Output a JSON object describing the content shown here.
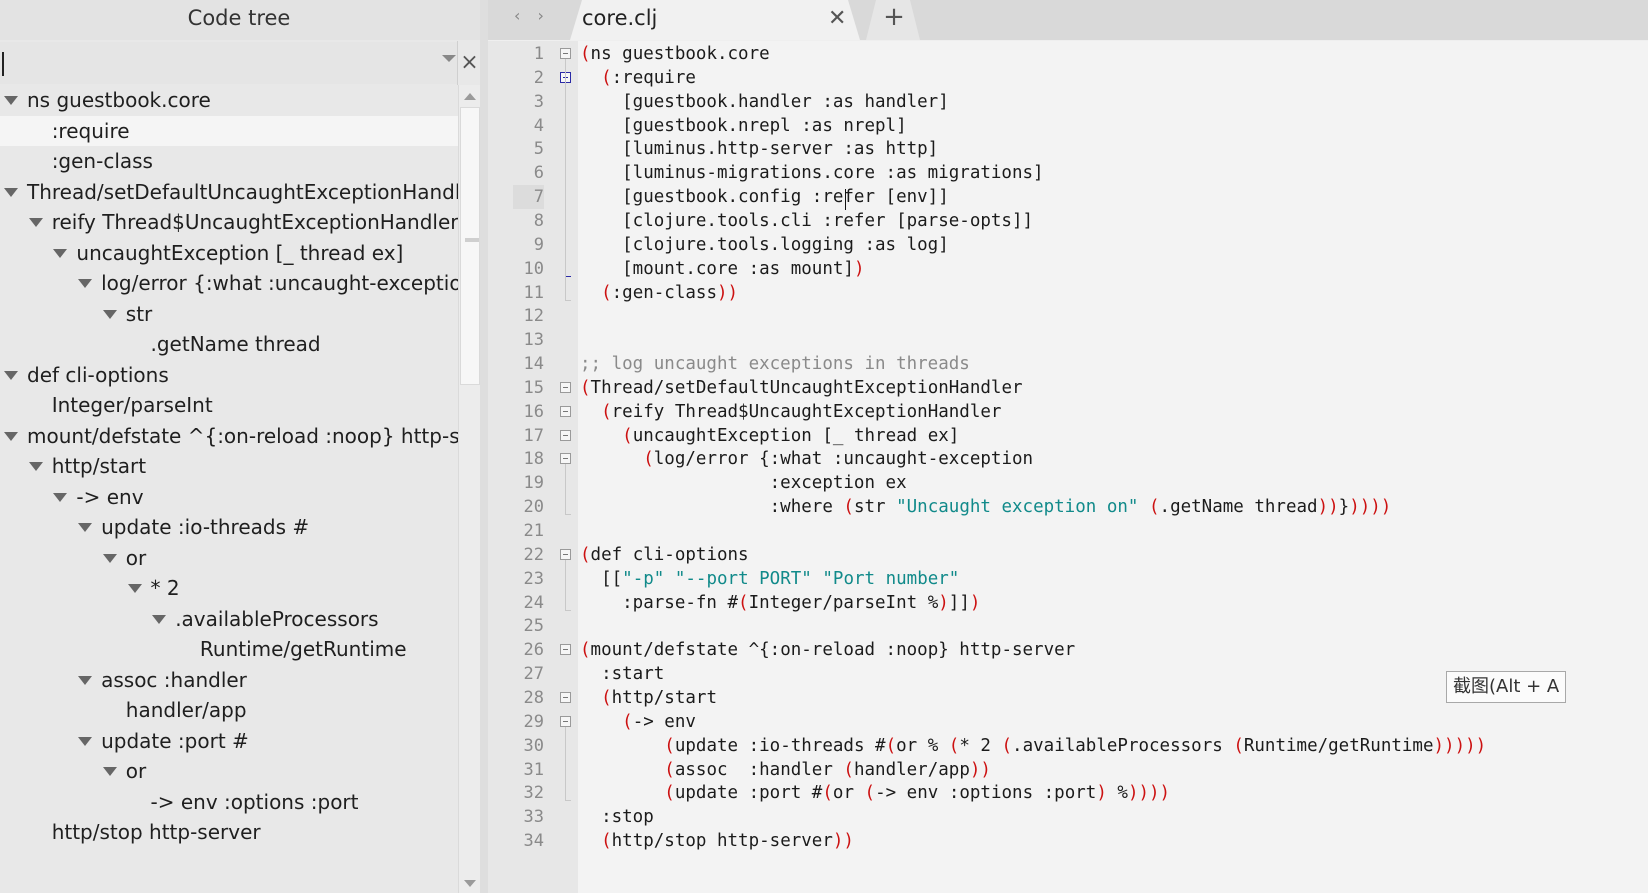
{
  "tree": {
    "title": "Code tree",
    "filter": {
      "value": "",
      "placeholder": ""
    },
    "close_glyph": "×",
    "items": [
      {
        "label": "ns guestbook.core",
        "depth": 0,
        "expandable": true,
        "selected": false
      },
      {
        "label": ":require",
        "depth": 1,
        "expandable": false,
        "selected": true
      },
      {
        "label": ":gen-class",
        "depth": 1,
        "expandable": false,
        "selected": false
      },
      {
        "label": "Thread/setDefaultUncaughtExceptionHandler",
        "depth": 0,
        "expandable": true,
        "selected": false
      },
      {
        "label": "reify Thread$UncaughtExceptionHandler",
        "depth": 1,
        "expandable": true,
        "selected": false
      },
      {
        "label": "uncaughtException [_ thread ex]",
        "depth": 2,
        "expandable": true,
        "selected": false
      },
      {
        "label": "log/error {:what :uncaught-exception",
        "depth": 3,
        "expandable": true,
        "selected": false
      },
      {
        "label": "str",
        "depth": 4,
        "expandable": true,
        "selected": false
      },
      {
        "label": ".getName thread",
        "depth": 5,
        "expandable": false,
        "selected": false
      },
      {
        "label": "def cli-options",
        "depth": 0,
        "expandable": true,
        "selected": false
      },
      {
        "label": "Integer/parseInt",
        "depth": 1,
        "expandable": false,
        "selected": false
      },
      {
        "label": "mount/defstate ^{:on-reload :noop} http-server",
        "depth": 0,
        "expandable": true,
        "selected": false
      },
      {
        "label": "http/start",
        "depth": 1,
        "expandable": true,
        "selected": false
      },
      {
        "label": "-> env",
        "depth": 2,
        "expandable": true,
        "selected": false
      },
      {
        "label": "update :io-threads #",
        "depth": 3,
        "expandable": true,
        "selected": false
      },
      {
        "label": "or",
        "depth": 4,
        "expandable": true,
        "selected": false
      },
      {
        "label": "* 2",
        "depth": 5,
        "expandable": true,
        "selected": false
      },
      {
        "label": ".availableProcessors",
        "depth": 6,
        "expandable": true,
        "selected": false
      },
      {
        "label": "Runtime/getRuntime",
        "depth": 7,
        "expandable": false,
        "selected": false
      },
      {
        "label": "assoc  :handler",
        "depth": 3,
        "expandable": true,
        "selected": false
      },
      {
        "label": "handler/app",
        "depth": 4,
        "expandable": false,
        "selected": false
      },
      {
        "label": "update :port #",
        "depth": 3,
        "expandable": true,
        "selected": false
      },
      {
        "label": "or",
        "depth": 4,
        "expandable": true,
        "selected": false
      },
      {
        "label": "-> env :options :port",
        "depth": 5,
        "expandable": false,
        "selected": false
      },
      {
        "label": "http/stop http-server",
        "depth": 1,
        "expandable": false,
        "selected": false
      }
    ]
  },
  "tabs": {
    "nav_label": "‹ ›",
    "active": {
      "label": "core.clj",
      "close_glyph": "✕"
    },
    "add_label": "+"
  },
  "editor": {
    "current_line": 7,
    "lines": [
      {
        "n": "1",
        "fold": "open",
        "segs": [
          [
            "p",
            "("
          ],
          [
            "t",
            "ns guestbook.core"
          ]
        ]
      },
      {
        "n": "2",
        "fold": "open-active",
        "segs": [
          [
            "t",
            "  "
          ],
          [
            "p",
            "("
          ],
          [
            "t",
            ":require"
          ]
        ]
      },
      {
        "n": "3",
        "fold": "",
        "segs": [
          [
            "t",
            "    [guestbook.handler :as handler]"
          ]
        ]
      },
      {
        "n": "4",
        "fold": "",
        "segs": [
          [
            "t",
            "    [guestbook.nrepl :as nrepl]"
          ]
        ]
      },
      {
        "n": "5",
        "fold": "",
        "segs": [
          [
            "t",
            "    [luminus.http-server :as http]"
          ]
        ]
      },
      {
        "n": "6",
        "fold": "",
        "segs": [
          [
            "t",
            "    [luminus-migrations.core :as migrations]"
          ]
        ]
      },
      {
        "n": "7",
        "fold": "",
        "segs": [
          [
            "t",
            "    [guestbook.config :refer [env]]"
          ]
        ]
      },
      {
        "n": "8",
        "fold": "",
        "segs": [
          [
            "t",
            "    [clojure.tools.cli :refer [parse-opts]]"
          ]
        ]
      },
      {
        "n": "9",
        "fold": "",
        "segs": [
          [
            "t",
            "    [clojure.tools.logging :as log]"
          ]
        ]
      },
      {
        "n": "10",
        "fold": "end-active",
        "segs": [
          [
            "t",
            "    [mount.core :as mount]"
          ],
          [
            "p",
            ")"
          ]
        ]
      },
      {
        "n": "11",
        "fold": "end",
        "segs": [
          [
            "t",
            "  "
          ],
          [
            "p",
            "("
          ],
          [
            "t",
            ":gen-class"
          ],
          [
            "p",
            "))"
          ]
        ]
      },
      {
        "n": "12",
        "fold": "",
        "segs": []
      },
      {
        "n": "13",
        "fold": "",
        "segs": []
      },
      {
        "n": "14",
        "fold": "",
        "segs": [
          [
            "c",
            ";; log uncaught exceptions in threads"
          ]
        ]
      },
      {
        "n": "15",
        "fold": "open",
        "segs": [
          [
            "p",
            "("
          ],
          [
            "t",
            "Thread/setDefaultUncaughtExceptionHandler"
          ]
        ]
      },
      {
        "n": "16",
        "fold": "open",
        "segs": [
          [
            "t",
            "  "
          ],
          [
            "p",
            "("
          ],
          [
            "t",
            "reify Thread$UncaughtExceptionHandler"
          ]
        ]
      },
      {
        "n": "17",
        "fold": "open",
        "segs": [
          [
            "t",
            "    "
          ],
          [
            "p",
            "("
          ],
          [
            "t",
            "uncaughtException [_ thread ex]"
          ]
        ]
      },
      {
        "n": "18",
        "fold": "open",
        "segs": [
          [
            "t",
            "      "
          ],
          [
            "p",
            "("
          ],
          [
            "t",
            "log/error {:what :uncaught-exception"
          ]
        ]
      },
      {
        "n": "19",
        "fold": "",
        "segs": [
          [
            "t",
            "                  :exception ex"
          ]
        ]
      },
      {
        "n": "20",
        "fold": "end",
        "segs": [
          [
            "t",
            "                  :where "
          ],
          [
            "p",
            "("
          ],
          [
            "t",
            "str "
          ],
          [
            "s",
            "\"Uncaught exception on\""
          ],
          [
            "t",
            " "
          ],
          [
            "p",
            "("
          ],
          [
            "t",
            ".getName thread"
          ],
          [
            "p",
            "))"
          ],
          [
            "t",
            "}"
          ],
          [
            "p",
            "))))"
          ]
        ]
      },
      {
        "n": "21",
        "fold": "",
        "segs": []
      },
      {
        "n": "22",
        "fold": "open",
        "segs": [
          [
            "p",
            "("
          ],
          [
            "t",
            "def cli-options"
          ]
        ]
      },
      {
        "n": "23",
        "fold": "",
        "segs": [
          [
            "t",
            "  [["
          ],
          [
            "s",
            "\"-p\""
          ],
          [
            "t",
            " "
          ],
          [
            "s",
            "\"--port PORT\""
          ],
          [
            "t",
            " "
          ],
          [
            "s",
            "\"Port number\""
          ]
        ]
      },
      {
        "n": "24",
        "fold": "end",
        "segs": [
          [
            "t",
            "    :parse-fn #"
          ],
          [
            "p",
            "("
          ],
          [
            "t",
            "Integer/parseInt %"
          ],
          [
            "p",
            ")"
          ],
          [
            "t",
            "]]"
          ],
          [
            "p",
            ")"
          ]
        ]
      },
      {
        "n": "25",
        "fold": "",
        "segs": []
      },
      {
        "n": "26",
        "fold": "open",
        "segs": [
          [
            "p",
            "("
          ],
          [
            "t",
            "mount/defstate ^{:on-reload :noop} http-server"
          ]
        ]
      },
      {
        "n": "27",
        "fold": "",
        "segs": [
          [
            "t",
            "  :start"
          ]
        ]
      },
      {
        "n": "28",
        "fold": "open",
        "segs": [
          [
            "t",
            "  "
          ],
          [
            "p",
            "("
          ],
          [
            "t",
            "http/start"
          ]
        ]
      },
      {
        "n": "29",
        "fold": "open",
        "segs": [
          [
            "t",
            "    "
          ],
          [
            "p",
            "("
          ],
          [
            "t",
            "-> env"
          ]
        ]
      },
      {
        "n": "30",
        "fold": "",
        "segs": [
          [
            "t",
            "        "
          ],
          [
            "p",
            "("
          ],
          [
            "t",
            "update :io-threads #"
          ],
          [
            "p",
            "("
          ],
          [
            "t",
            "or % "
          ],
          [
            "p",
            "("
          ],
          [
            "t",
            "* 2 "
          ],
          [
            "p",
            "("
          ],
          [
            "t",
            ".availableProcessors "
          ],
          [
            "p",
            "("
          ],
          [
            "t",
            "Runtime/getRuntime"
          ],
          [
            "p",
            ")))))"
          ]
        ]
      },
      {
        "n": "31",
        "fold": "",
        "segs": [
          [
            "t",
            "        "
          ],
          [
            "p",
            "("
          ],
          [
            "t",
            "assoc  :handler "
          ],
          [
            "p",
            "("
          ],
          [
            "t",
            "handler/app"
          ],
          [
            "p",
            "))"
          ]
        ]
      },
      {
        "n": "32",
        "fold": "end",
        "segs": [
          [
            "t",
            "        "
          ],
          [
            "p",
            "("
          ],
          [
            "t",
            "update :port #"
          ],
          [
            "p",
            "("
          ],
          [
            "t",
            "or "
          ],
          [
            "p",
            "("
          ],
          [
            "t",
            "-> env :options :port"
          ],
          [
            "p",
            ")"
          ],
          [
            "t",
            " %"
          ],
          [
            "p",
            "))))"
          ]
        ]
      },
      {
        "n": "33",
        "fold": "",
        "segs": [
          [
            "t",
            "  :stop"
          ]
        ]
      },
      {
        "n": "34",
        "fold": "",
        "segs": [
          [
            "t",
            "  "
          ],
          [
            "p",
            "("
          ],
          [
            "t",
            "http/stop http-server"
          ],
          [
            "p",
            "))"
          ]
        ]
      }
    ]
  },
  "tooltip": {
    "text": "截图(Alt + A"
  },
  "colors": {
    "paren": "#cc1111",
    "string": "#118a8a",
    "comment": "#8a8a8a",
    "fold_active": "#2a2aa6"
  },
  "icons": {
    "tree_expand": "triangle-down-icon",
    "filter_dropdown": "chevron-down-icon",
    "filter_close": "close-icon",
    "tab_close": "close-icon",
    "tab_add": "plus-icon",
    "fold": "fold-minus-icon"
  }
}
